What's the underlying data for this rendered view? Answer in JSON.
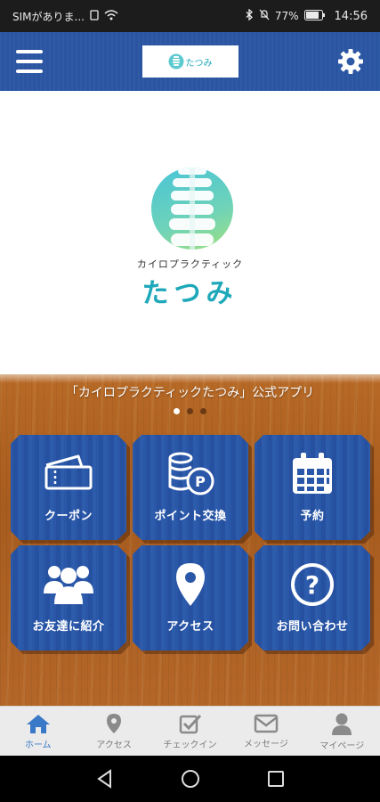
{
  "status_bar": {
    "carrier": "SIMがありま...",
    "battery": "77%",
    "time": "14:56"
  },
  "header": {
    "logo_text": "たつみ"
  },
  "hero": {
    "logo_sub": "カイロプラクティック",
    "logo_main": "たつみ"
  },
  "panel": {
    "caption": "「カイロプラクティックたつみ」公式アプリ",
    "slide_count": 3,
    "active_slide": 1
  },
  "tiles": [
    {
      "label": "クーポン",
      "icon": "ticket-icon"
    },
    {
      "label": "ポイント交換",
      "icon": "coins-icon"
    },
    {
      "label": "予約",
      "icon": "calendar-icon"
    },
    {
      "label": "お友達に紹介",
      "icon": "people-icon"
    },
    {
      "label": "アクセス",
      "icon": "map-pin-icon"
    },
    {
      "label": "お問い合わせ",
      "icon": "question-icon"
    }
  ],
  "bottom_nav": [
    {
      "label": "ホーム",
      "icon": "home-icon",
      "active": true
    },
    {
      "label": "アクセス",
      "icon": "map-pin-icon",
      "active": false
    },
    {
      "label": "チェックイン",
      "icon": "checkin-icon",
      "active": false
    },
    {
      "label": "メッセージ",
      "icon": "mail-icon",
      "active": false
    },
    {
      "label": "マイページ",
      "icon": "user-icon",
      "active": false
    }
  ],
  "colors": {
    "header_blue": "#2f5aa6",
    "tile_blue": "#2a57a8",
    "wood": "#b36628",
    "nav_active": "#3a78c8",
    "logo_teal": "#1ea8b9"
  }
}
